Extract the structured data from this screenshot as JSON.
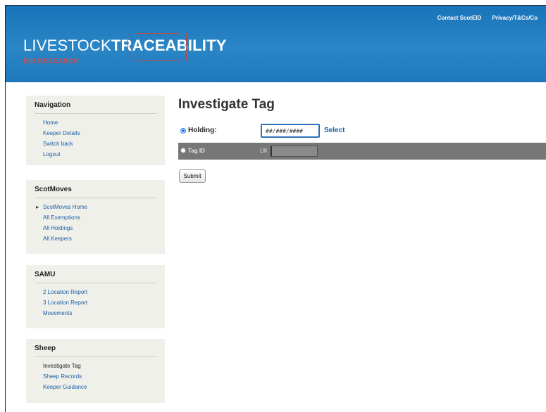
{
  "header": {
    "links": [
      "Contact ScotEID",
      "Privacy/T&Cs/Co"
    ],
    "logo_light": "LIVESTOCK",
    "logo_bold": "TRACEABILITY",
    "logo_sub": "EID RESEARCH"
  },
  "sidebar": {
    "navigation": {
      "title": "Navigation",
      "items": [
        "Home",
        "Keeper Details",
        "Switch back",
        "Logout"
      ]
    },
    "scotmoves": {
      "title": "ScotMoves",
      "items": [
        "ScotMoves Home",
        "All Exemptions",
        "All Holdings",
        "All Keepers"
      ]
    },
    "samu": {
      "title": "SAMU",
      "items": [
        "2 Location Report",
        "3 Location Report",
        "Movements"
      ]
    },
    "sheep": {
      "title": "Sheep",
      "items": [
        "Investigate Tag",
        "Sheep Records",
        "Keeper Guidance"
      ]
    }
  },
  "main": {
    "title": "Investigate Tag",
    "holding_label": "Holding:",
    "holding_value": "##/###/####",
    "select_label": "Select",
    "tag_label": "Tag ID",
    "tag_prefix": "UK",
    "tag_value": "",
    "submit_label": "Submit"
  },
  "colors": {
    "header_blue": "#1f78bb",
    "link_blue": "#1a5fa8",
    "logo_red": "#d64c4c",
    "panel_bg": "#f0f0ea",
    "tag_row_bg": "#777777"
  }
}
